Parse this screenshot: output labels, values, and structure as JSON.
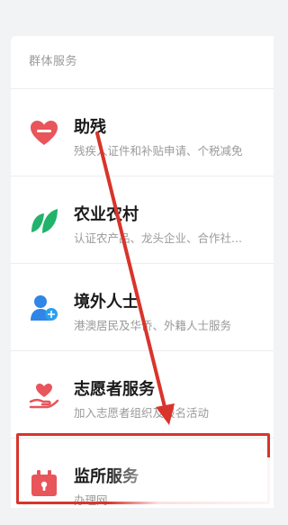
{
  "section": {
    "title": "群体服务"
  },
  "items": [
    {
      "title": "助残",
      "subtitle": "残疾人证件和补贴申请、个税减免",
      "icon": "heart-icon",
      "color": "#e8555a"
    },
    {
      "title": "农业农村",
      "subtitle": "认证农产品、龙头企业、合作社...",
      "icon": "leaf-icon",
      "color": "#22b36b"
    },
    {
      "title": "境外人士",
      "subtitle": "港澳居民及华侨、外籍人士服务",
      "icon": "person-icon",
      "color": "#2f86e6"
    },
    {
      "title": "志愿者服务",
      "subtitle": "加入志愿者组织及报名活动",
      "icon": "volunteer-hand-icon",
      "color": "#e8555a"
    },
    {
      "title": "监所服务",
      "subtitle": "办理网",
      "icon": "prison-lock-icon",
      "color": "#e8555a"
    }
  ],
  "annotation": {
    "color": "#d9342b"
  }
}
